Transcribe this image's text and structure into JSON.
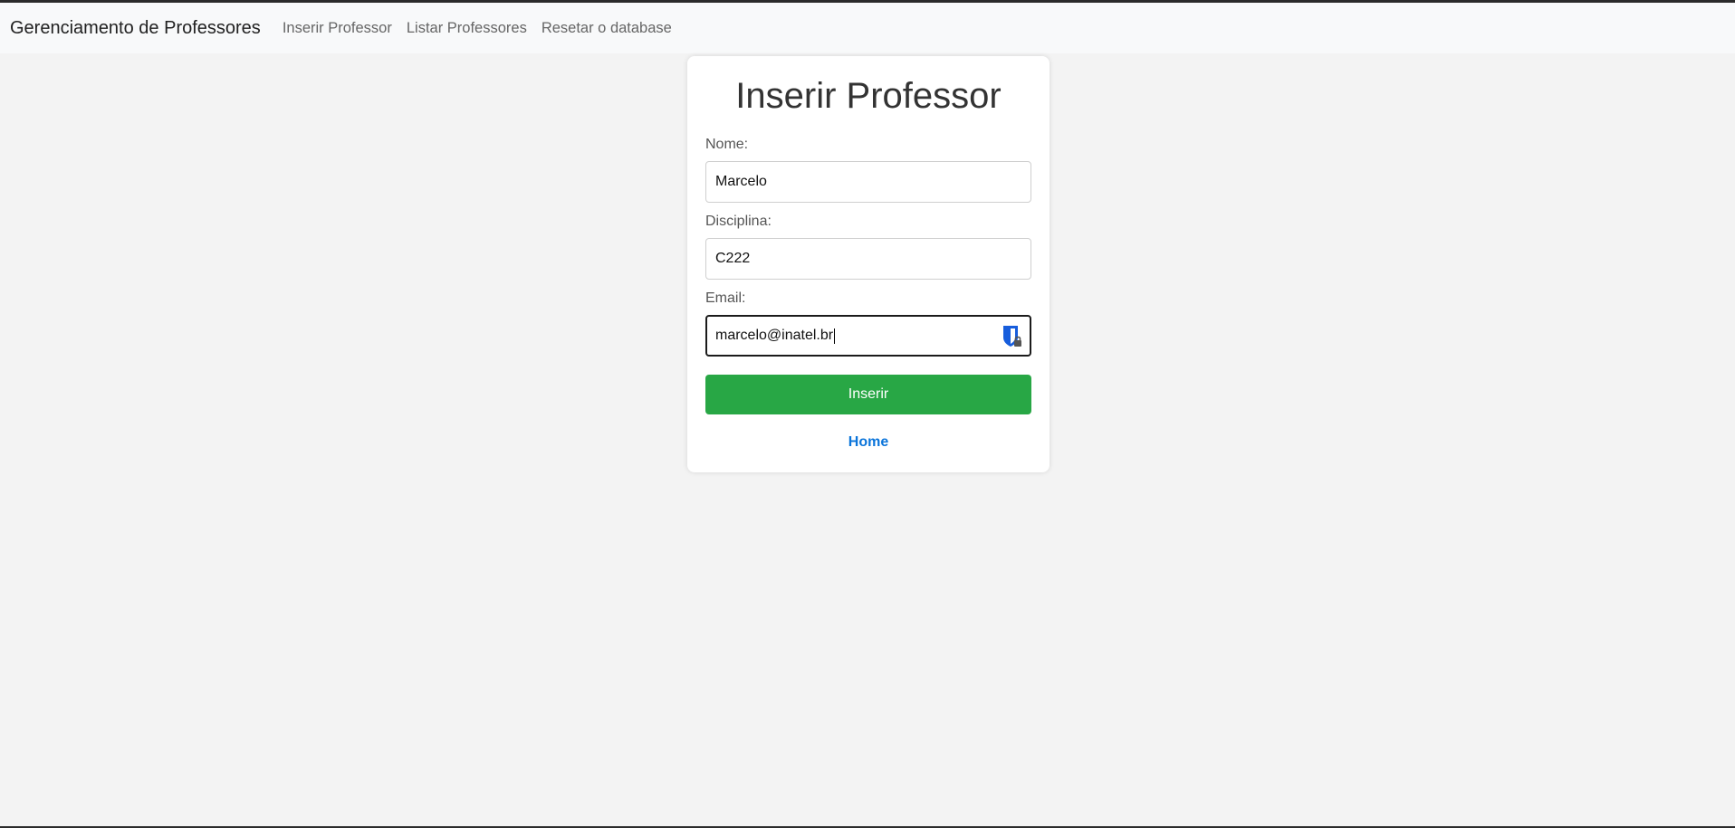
{
  "navbar": {
    "brand": "Gerenciamento de Professores",
    "links": [
      {
        "label": "Inserir Professor"
      },
      {
        "label": "Listar Professores"
      },
      {
        "label": "Resetar o database"
      }
    ]
  },
  "form": {
    "title": "Inserir Professor",
    "nome": {
      "label": "Nome:",
      "value": "Marcelo"
    },
    "disciplina": {
      "label": "Disciplina:",
      "value": "C222"
    },
    "email": {
      "label": "Email:",
      "value": "marcelo@inatel.br"
    },
    "submit_label": "Inserir",
    "home_label": "Home"
  },
  "icons": {
    "password_manager": "password-manager-shield-icon"
  },
  "colors": {
    "submit": "#28a745",
    "link": "#0a74da",
    "pw_icon": "#175ddc"
  }
}
